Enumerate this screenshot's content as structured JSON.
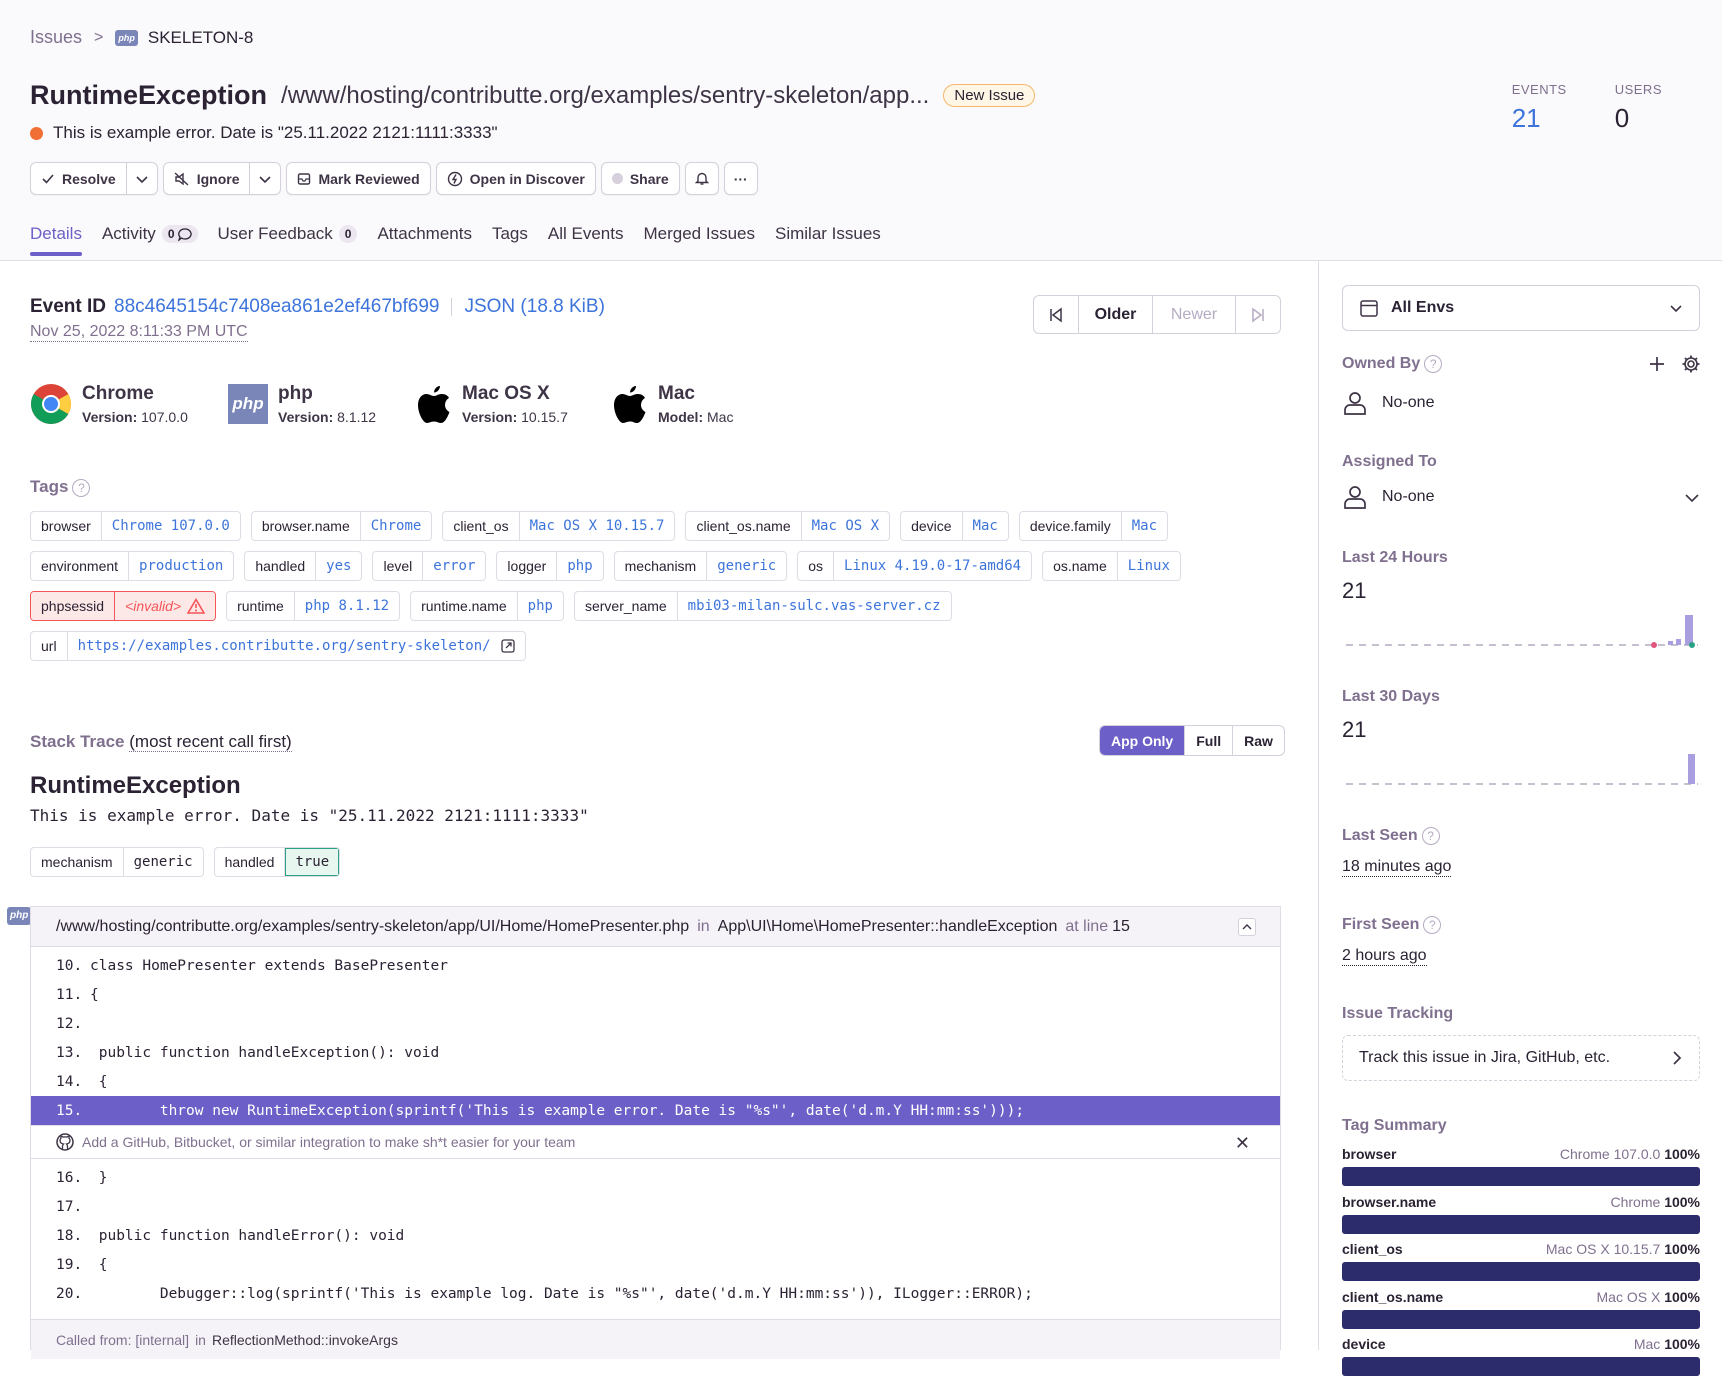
{
  "breadcrumb": {
    "root": "Issues",
    "project_badge": "php",
    "issue_id": "SKELETON-8"
  },
  "issue": {
    "title": "RuntimeException",
    "culprit": "/www/hosting/contributte.org/examples/sentry-skeleton/app...",
    "badge": "New Issue",
    "message": "This is example error. Date is \"25.11.2022 2121:1111:3333\"",
    "level_color": "#f06f35"
  },
  "stats": {
    "events_label": "EVENTS",
    "events": "21",
    "users_label": "USERS",
    "users": "0"
  },
  "actions": {
    "resolve": "Resolve",
    "ignore": "Ignore",
    "mark_reviewed": "Mark Reviewed",
    "open_discover": "Open in Discover",
    "share": "Share",
    "more": "···"
  },
  "tabs": [
    {
      "label": "Details"
    },
    {
      "label": "Activity",
      "count": "0"
    },
    {
      "label": "User Feedback",
      "count": "0"
    },
    {
      "label": "Attachments"
    },
    {
      "label": "Tags"
    },
    {
      "label": "All Events"
    },
    {
      "label": "Merged Issues"
    },
    {
      "label": "Similar Issues"
    }
  ],
  "event": {
    "id_label": "Event ID",
    "id": "88c4645154c7408ea861e2ef467bf699",
    "json_link": "JSON (18.8 KiB)",
    "date": "Nov 25, 2022 8:11:33 PM UTC",
    "nav_older": "Older",
    "nav_newer": "Newer"
  },
  "contexts": [
    {
      "name": "Chrome",
      "key": "Version:",
      "value": "107.0.0",
      "icon": "chrome-icon"
    },
    {
      "name": "php",
      "key": "Version:",
      "value": "8.1.12",
      "icon": "php-icon"
    },
    {
      "name": "Mac OS X",
      "key": "Version:",
      "value": "10.15.7",
      "icon": "apple-icon"
    },
    {
      "name": "Mac",
      "key": "Model:",
      "value": "Mac",
      "icon": "apple-icon"
    }
  ],
  "tags_label": "Tags",
  "tags": [
    [
      {
        "k": "browser",
        "v": "Chrome 107.0.0"
      },
      {
        "k": "browser.name",
        "v": "Chrome"
      },
      {
        "k": "client_os",
        "v": "Mac OS X 10.15.7"
      },
      {
        "k": "client_os.name",
        "v": "Mac OS X"
      },
      {
        "k": "device",
        "v": "Mac"
      },
      {
        "k": "device.family",
        "v": "Mac"
      }
    ],
    [
      {
        "k": "environment",
        "v": "production"
      },
      {
        "k": "handled",
        "v": "yes"
      },
      {
        "k": "level",
        "v": "error"
      },
      {
        "k": "logger",
        "v": "php"
      },
      {
        "k": "mechanism",
        "v": "generic"
      },
      {
        "k": "os",
        "v": "Linux 4.19.0-17-amd64"
      },
      {
        "k": "os.name",
        "v": "Linux"
      }
    ],
    [
      {
        "k": "phpsessid",
        "v": "<invalid>",
        "error": true
      },
      {
        "k": "runtime",
        "v": "php 8.1.12"
      },
      {
        "k": "runtime.name",
        "v": "php"
      },
      {
        "k": "server_name",
        "v": "mbi03-milan-sulc.vas-server.cz"
      }
    ],
    [
      {
        "k": "url",
        "v": "https://examples.contributte.org/sentry-skeleton/",
        "link": true
      }
    ]
  ],
  "stacktrace": {
    "label": "Stack Trace",
    "order": "(most recent call first)",
    "modes": [
      "App Only",
      "Full",
      "Raw"
    ],
    "exception_type": "RuntimeException",
    "exception_value": "This is example error. Date is \"25.11.2022 2121:1111:3333\"",
    "mechanism": {
      "k": "mechanism",
      "v": "generic"
    },
    "handled": {
      "k": "handled",
      "v": "true"
    },
    "frame": {
      "file": "/www/hosting/contributte.org/examples/sentry-skeleton/app/UI/Home/HomePresenter.php",
      "in": "in",
      "function": "App\\UI\\Home\\HomePresenter::handleException",
      "at_line": "at line",
      "line": "15"
    },
    "lines_before": [
      {
        "n": "10.",
        "code": "class HomePresenter extends BasePresenter"
      },
      {
        "n": "11.",
        "code": "{"
      },
      {
        "n": "12.",
        "code": ""
      },
      {
        "n": "13.",
        "code": " public function handleException(): void"
      },
      {
        "n": "14.",
        "code": " {"
      },
      {
        "n": "15.",
        "code": "        throw new RuntimeException(sprintf('This is example error. Date is \"%s\"', date('d.m.Y HH:mm:ss')));",
        "highlight": true
      }
    ],
    "integration_prompt": "Add a GitHub, Bitbucket, or similar integration to make sh*t easier for your team",
    "lines_after": [
      {
        "n": "16.",
        "code": " }"
      },
      {
        "n": "17.",
        "code": ""
      },
      {
        "n": "18.",
        "code": " public function handleError(): void"
      },
      {
        "n": "19.",
        "code": " {"
      },
      {
        "n": "20.",
        "code": "        Debugger::log(sprintf('This is example log. Date is \"%s\"', date('d.m.Y HH:mm:ss')), ILogger::ERROR);"
      }
    ],
    "called_from_label": "Called from: [internal]",
    "called_in": "in",
    "called_function": "ReflectionMethod::invokeArgs"
  },
  "sidebar": {
    "env": "All Envs",
    "owned_by_label": "Owned By",
    "owned_by": "No-one",
    "assigned_to_label": "Assigned To",
    "assigned_to": "No-one",
    "last24_label": "Last 24 Hours",
    "last24": "21",
    "last30_label": "Last 30 Days",
    "last30": "21",
    "last_seen_label": "Last Seen",
    "last_seen": "18 minutes ago",
    "first_seen_label": "First Seen",
    "first_seen": "2 hours ago",
    "issue_tracking_label": "Issue Tracking",
    "issue_tracking": "Track this issue in Jira, GitHub, etc.",
    "tag_summary_label": "Tag Summary",
    "tag_summary": [
      {
        "key": "browser",
        "value": "Chrome 107.0.0",
        "pct": "100%"
      },
      {
        "key": "browser.name",
        "value": "Chrome",
        "pct": "100%"
      },
      {
        "key": "client_os",
        "value": "Mac OS X 10.15.7",
        "pct": "100%"
      },
      {
        "key": "client_os.name",
        "value": "Mac OS X",
        "pct": "100%"
      },
      {
        "key": "device",
        "value": "Mac",
        "pct": "100%"
      }
    ]
  },
  "colors": {
    "accent": "#6c5fc7",
    "link": "#3d74db",
    "bar": "#2c2b6b",
    "error": "#f55459"
  }
}
